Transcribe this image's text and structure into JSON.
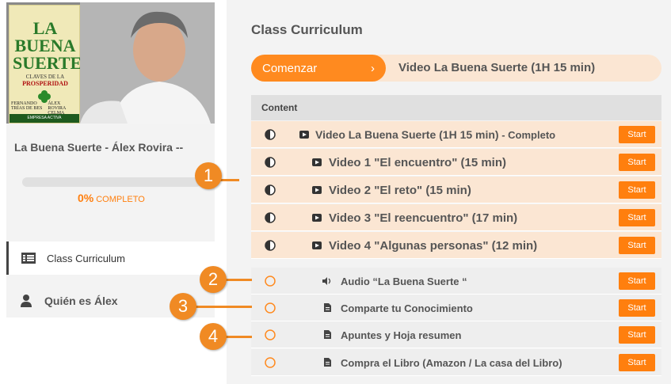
{
  "sidebar": {
    "course_title": "La Buena Suerte  -  Álex Rovira --",
    "progress": {
      "percent_text": "0%",
      "label": "COMPLETO",
      "value": 0
    },
    "nav": [
      {
        "label": "Class Curriculum",
        "icon": "list-icon",
        "active": true
      },
      {
        "label": "Quién es Álex",
        "icon": "user-icon",
        "active": false
      }
    ],
    "book_cover": {
      "title": "LA BUENA SUERTE",
      "subtitle": "CLAVES DE LA",
      "subtitle2": "PROSPERIDAD",
      "author1": "FERNANDO TRÍAS DE BES",
      "author2": "ÁLEX ROVIRA CELMA",
      "publisher": "EMPRESA ACTIVA"
    }
  },
  "main": {
    "title": "Class Curriculum",
    "start_button": {
      "label": "Comenzar",
      "chevron": "›"
    },
    "next_item": "Video La Buena Suerte  (1H 15 min)",
    "content_header": "Content",
    "start_label": "Start",
    "items": [
      {
        "type": "video",
        "label": "Video La Buena Suerte  (1H 15 min)",
        "suffix": " - Completo",
        "state": "half",
        "indent": false
      },
      {
        "type": "video",
        "label": "Video  1 \"El encuentro\" (15 min)",
        "suffix": "",
        "state": "half",
        "indent": true
      },
      {
        "type": "video",
        "label": "Video  2 \"El reto\" (15 min)",
        "suffix": "",
        "state": "half",
        "indent": true
      },
      {
        "type": "video",
        "label": "Video  3 \"El reencuentro\" (17 min)",
        "suffix": "",
        "state": "half",
        "indent": true
      },
      {
        "type": "video",
        "label": "Video  4 \"Algunas personas\" (12 min)",
        "suffix": "",
        "state": "half",
        "indent": true
      },
      {
        "type": "audio",
        "label": "Audio  “La Buena Suerte “",
        "suffix": "",
        "state": "empty",
        "indent": false
      },
      {
        "type": "text",
        "label": "Comparte tu Conocimiento",
        "suffix": "",
        "state": "empty",
        "indent": false
      },
      {
        "type": "text",
        "label": "Apuntes y Hoja resumen",
        "suffix": "",
        "state": "empty",
        "indent": false
      },
      {
        "type": "text",
        "label": "Compra el Libro (Amazon / La casa del Libro)",
        "suffix": "",
        "state": "empty",
        "indent": false
      }
    ]
  },
  "annotations": [
    "1",
    "2",
    "3",
    "4"
  ],
  "colors": {
    "accent": "#ff7f0e",
    "row_highlight": "#fbe6d3",
    "row_gray": "#eeeeee"
  }
}
